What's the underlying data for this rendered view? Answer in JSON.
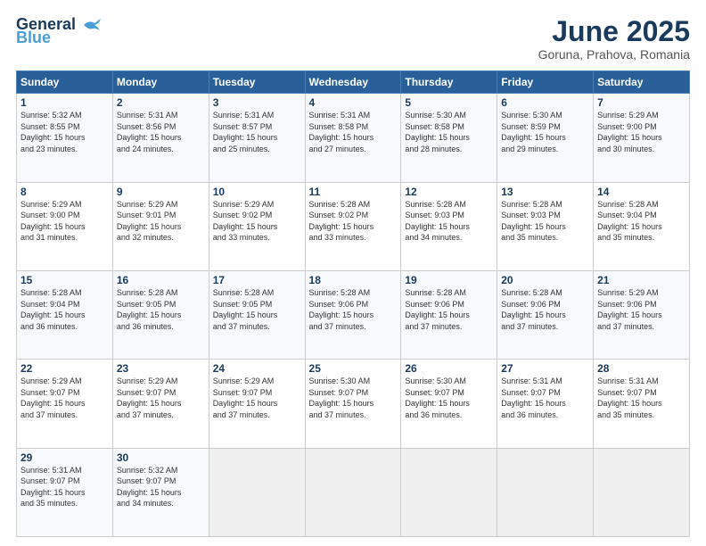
{
  "logo": {
    "line1": "General",
    "line2": "Blue"
  },
  "title": {
    "month_year": "June 2025",
    "location": "Goruna, Prahova, Romania"
  },
  "header_days": [
    "Sunday",
    "Monday",
    "Tuesday",
    "Wednesday",
    "Thursday",
    "Friday",
    "Saturday"
  ],
  "weeks": [
    [
      {
        "day": "1",
        "sunrise": "5:32 AM",
        "sunset": "8:55 PM",
        "daylight": "15 hours and 23 minutes."
      },
      {
        "day": "2",
        "sunrise": "5:31 AM",
        "sunset": "8:56 PM",
        "daylight": "15 hours and 24 minutes."
      },
      {
        "day": "3",
        "sunrise": "5:31 AM",
        "sunset": "8:57 PM",
        "daylight": "15 hours and 25 minutes."
      },
      {
        "day": "4",
        "sunrise": "5:31 AM",
        "sunset": "8:58 PM",
        "daylight": "15 hours and 27 minutes."
      },
      {
        "day": "5",
        "sunrise": "5:30 AM",
        "sunset": "8:58 PM",
        "daylight": "15 hours and 28 minutes."
      },
      {
        "day": "6",
        "sunrise": "5:30 AM",
        "sunset": "8:59 PM",
        "daylight": "15 hours and 29 minutes."
      },
      {
        "day": "7",
        "sunrise": "5:29 AM",
        "sunset": "9:00 PM",
        "daylight": "15 hours and 30 minutes."
      }
    ],
    [
      {
        "day": "8",
        "sunrise": "5:29 AM",
        "sunset": "9:00 PM",
        "daylight": "15 hours and 31 minutes."
      },
      {
        "day": "9",
        "sunrise": "5:29 AM",
        "sunset": "9:01 PM",
        "daylight": "15 hours and 32 minutes."
      },
      {
        "day": "10",
        "sunrise": "5:29 AM",
        "sunset": "9:02 PM",
        "daylight": "15 hours and 33 minutes."
      },
      {
        "day": "11",
        "sunrise": "5:28 AM",
        "sunset": "9:02 PM",
        "daylight": "15 hours and 33 minutes."
      },
      {
        "day": "12",
        "sunrise": "5:28 AM",
        "sunset": "9:03 PM",
        "daylight": "15 hours and 34 minutes."
      },
      {
        "day": "13",
        "sunrise": "5:28 AM",
        "sunset": "9:03 PM",
        "daylight": "15 hours and 35 minutes."
      },
      {
        "day": "14",
        "sunrise": "5:28 AM",
        "sunset": "9:04 PM",
        "daylight": "15 hours and 35 minutes."
      }
    ],
    [
      {
        "day": "15",
        "sunrise": "5:28 AM",
        "sunset": "9:04 PM",
        "daylight": "15 hours and 36 minutes."
      },
      {
        "day": "16",
        "sunrise": "5:28 AM",
        "sunset": "9:05 PM",
        "daylight": "15 hours and 36 minutes."
      },
      {
        "day": "17",
        "sunrise": "5:28 AM",
        "sunset": "9:05 PM",
        "daylight": "15 hours and 37 minutes."
      },
      {
        "day": "18",
        "sunrise": "5:28 AM",
        "sunset": "9:06 PM",
        "daylight": "15 hours and 37 minutes."
      },
      {
        "day": "19",
        "sunrise": "5:28 AM",
        "sunset": "9:06 PM",
        "daylight": "15 hours and 37 minutes."
      },
      {
        "day": "20",
        "sunrise": "5:28 AM",
        "sunset": "9:06 PM",
        "daylight": "15 hours and 37 minutes."
      },
      {
        "day": "21",
        "sunrise": "5:29 AM",
        "sunset": "9:06 PM",
        "daylight": "15 hours and 37 minutes."
      }
    ],
    [
      {
        "day": "22",
        "sunrise": "5:29 AM",
        "sunset": "9:07 PM",
        "daylight": "15 hours and 37 minutes."
      },
      {
        "day": "23",
        "sunrise": "5:29 AM",
        "sunset": "9:07 PM",
        "daylight": "15 hours and 37 minutes."
      },
      {
        "day": "24",
        "sunrise": "5:29 AM",
        "sunset": "9:07 PM",
        "daylight": "15 hours and 37 minutes."
      },
      {
        "day": "25",
        "sunrise": "5:30 AM",
        "sunset": "9:07 PM",
        "daylight": "15 hours and 37 minutes."
      },
      {
        "day": "26",
        "sunrise": "5:30 AM",
        "sunset": "9:07 PM",
        "daylight": "15 hours and 36 minutes."
      },
      {
        "day": "27",
        "sunrise": "5:31 AM",
        "sunset": "9:07 PM",
        "daylight": "15 hours and 36 minutes."
      },
      {
        "day": "28",
        "sunrise": "5:31 AM",
        "sunset": "9:07 PM",
        "daylight": "15 hours and 35 minutes."
      }
    ],
    [
      {
        "day": "29",
        "sunrise": "5:31 AM",
        "sunset": "9:07 PM",
        "daylight": "15 hours and 35 minutes."
      },
      {
        "day": "30",
        "sunrise": "5:32 AM",
        "sunset": "9:07 PM",
        "daylight": "15 hours and 34 minutes."
      },
      null,
      null,
      null,
      null,
      null
    ]
  ],
  "labels": {
    "sunrise": "Sunrise:",
    "sunset": "Sunset:",
    "daylight": "Daylight:"
  }
}
